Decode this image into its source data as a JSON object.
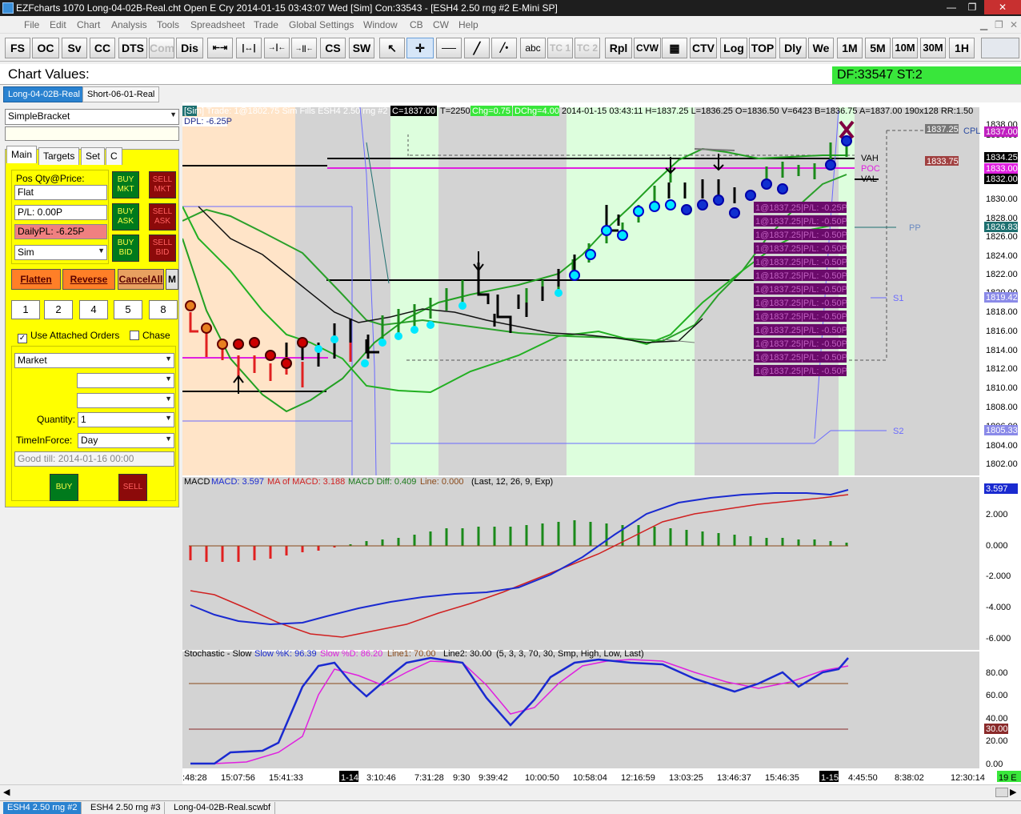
{
  "window": {
    "title": "EZFcharts 1070 Long-04-02B-Real.cht  Open E Cry 2014-01-15  03:43:07 Wed [Sim]  Con:33543 - [ESH4  2.50 rng  #2  E-Mini SP]",
    "min": "—",
    "max": "❐",
    "close": "✕"
  },
  "menu": [
    "File",
    "Edit",
    "Chart",
    "Analysis",
    "Tools",
    "Spreadsheet",
    "Trade",
    "Global Settings",
    "Window",
    "CB",
    "CW",
    "Help"
  ],
  "toolbar": [
    "FS",
    "OC",
    "Sv",
    "CC",
    "DTS",
    "Com",
    "Dis",
    "⇤⇥",
    "|↔|",
    "→|←",
    "→||←",
    "CS",
    "SW",
    "↖",
    "✛",
    "——",
    "╱",
    "╱•",
    "abc",
    "TC 1",
    "TC 2",
    "Rpl",
    "CVW",
    "▦",
    "CTV",
    "Log",
    "TOP",
    "Dly",
    "We",
    "1M",
    "5M",
    "10M",
    "30M",
    "1H"
  ],
  "values_bar": {
    "label": "Chart Values:",
    "df": "DF:33547   ST:2"
  },
  "chart_tabs": [
    "Long-04-02B-Real",
    "Short-06-01-Real"
  ],
  "panel": {
    "strategy": "SimpleBracket",
    "tabs": [
      "Main",
      "Targets",
      "Set",
      "C"
    ],
    "pos_label": "Pos Qty@Price:",
    "pos_value": "Flat",
    "pl": "P/L: 0.00P",
    "daily_pl": "DailyPL: -6.25P",
    "account": "Sim",
    "buy_mkt": "BUY MKT",
    "sell_mkt": "SELL MKT",
    "buy_ask": "BUY ASK",
    "sell_ask": "SELL ASK",
    "buy_bid": "BUY BID",
    "sell_bid": "SELL BID",
    "flatten": "Flatten",
    "reverse": "Reverse",
    "cancel_all": "CancelAll",
    "m": "M",
    "qty_buttons": [
      "1",
      "2",
      "4",
      "5",
      "8"
    ],
    "use_attached": "Use Attached Orders",
    "chase": "Chase",
    "order_type": "Market",
    "quantity_label": "Quantity:",
    "quantity": "1",
    "tif_label": "TimeInForce:",
    "tif": "Day",
    "good_till": "Good till: 2014-01-16 00:00",
    "buy": "BUY",
    "sell": "SELL"
  },
  "chart": {
    "info_line": "[Sim]  Trade: 1@1802.75 Sim Fills  ESH4  2.50 rng  #2",
    "c_box": "C=1837.00",
    "t_text": "T=2250",
    "chg": "Chg=0.75",
    "dchg": "DChg=4.00",
    "ohlc": "2014-01-15 03:43:11 H=1837.25 L=1836.25 O=1836.50 V=6423 B=1836.75 A=1837.00 190x128 RR:1.50",
    "dpl": "DPL: -6.25P",
    "levels": {
      "cpl": "CPL",
      "vah": "VAH",
      "poc": "POC",
      "val": "VAL",
      "pp": "PP",
      "s1": "S1",
      "s2": "S2"
    },
    "fill_labels": [
      "1@1837.25|P/L: -0.25P",
      "1@1837.25|P/L: -0.50P",
      "1@1837.25|P/L: -0.50P",
      "1@1837.25|P/L: -0.50P",
      "1@1837.25|P/L: -0.50P",
      "1@1837.25|P/L: -0.50P",
      "1@1837.25|P/L: -0.50P",
      "1@1837.25|P/L: -0.50P",
      "1@1837.25|P/L: -0.50P",
      "1@1837.25|P/L: -0.50P",
      "1@1837.25|P/L: -0.50P",
      "1@1837.25|P/L: -0.50P",
      "1@1837.25|P/L: -0.50P"
    ],
    "price_axis": [
      "1838.00",
      "1836.00",
      "1834.25",
      "1833.00",
      "1832.00",
      "1830.00",
      "1828.00",
      "1826.00",
      "1824.00",
      "1822.00",
      "1820.00",
      "1818.00",
      "1816.00",
      "1814.00",
      "1812.00",
      "1810.00",
      "1808.00",
      "1806.00",
      "1804.00",
      "1802.00"
    ],
    "price_tags": {
      "last": "1837.00",
      "vah": "1834.25",
      "poc": "1833.00",
      "val": "1832.00",
      "pp": "1826.83",
      "s1": "1819.42",
      "s2": "1805.33",
      "cpl": "1837.25",
      "brk": "1833.75"
    },
    "macd_title": "MACD",
    "macd_val": "MACD: 3.597",
    "macd_ma": "MA of MACD: 3.188",
    "macd_diff": "MACD Diff: 0.409",
    "macd_line": "Line: 0.000",
    "macd_params": "(Last, 12, 26, 9, Exp)",
    "macd_axis": [
      "2.000",
      "0.000",
      "-2.000",
      "-4.000",
      "-6.000"
    ],
    "macd_tag": "3.597",
    "stoch_title": "Stochastic - Slow",
    "stoch_k": "Slow %K: 96.39",
    "stoch_d": "Slow %D: 86.20",
    "stoch_l1": "Line1: 70.00",
    "stoch_l2": "Line2: 30.00",
    "stoch_params": "(5, 3, 3, 70, 30, Smp, High, Low, Last)",
    "stoch_axis": [
      "80.00",
      "60.00",
      "40.00",
      "20.00",
      "0.00"
    ],
    "stoch_tag": "30.00",
    "time_axis": [
      ":48:28",
      "15:07:56",
      "15:41:33",
      "1-14",
      "3:10:46",
      "7:31:28",
      "9:30",
      "9:39:42",
      "10:00:50",
      "10:58:04",
      "12:16:59",
      "13:03:25",
      "13:46:37",
      "15:46:35",
      "1-15",
      "4:45:50",
      "8:38:02",
      "12:30:14",
      "19 E"
    ]
  },
  "status_tabs": [
    "ESH4  2.50 rng  #2",
    "ESH4  2.50 rng  #3",
    "Long-04-02B-Real.scwbf"
  ],
  "colors": {
    "accent": "#39e63b",
    "buy": "#007a1c",
    "sell": "#8c0a0a",
    "panel": "#ffff00"
  }
}
